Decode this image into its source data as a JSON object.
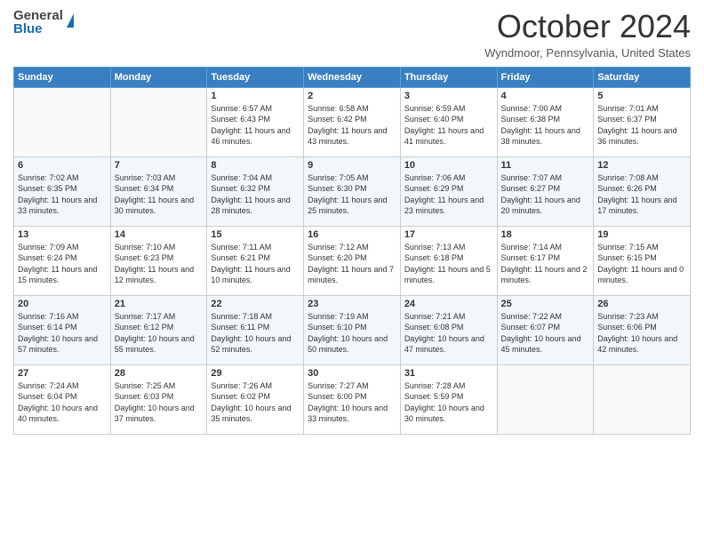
{
  "header": {
    "logo_general": "General",
    "logo_blue": "Blue",
    "month_title": "October 2024",
    "subtitle": "Wyndmoor, Pennsylvania, United States"
  },
  "days_of_week": [
    "Sunday",
    "Monday",
    "Tuesday",
    "Wednesday",
    "Thursday",
    "Friday",
    "Saturday"
  ],
  "weeks": [
    [
      {
        "day": "",
        "detail": ""
      },
      {
        "day": "",
        "detail": ""
      },
      {
        "day": "1",
        "detail": "Sunrise: 6:57 AM\nSunset: 6:43 PM\nDaylight: 11 hours and 46 minutes."
      },
      {
        "day": "2",
        "detail": "Sunrise: 6:58 AM\nSunset: 6:42 PM\nDaylight: 11 hours and 43 minutes."
      },
      {
        "day": "3",
        "detail": "Sunrise: 6:59 AM\nSunset: 6:40 PM\nDaylight: 11 hours and 41 minutes."
      },
      {
        "day": "4",
        "detail": "Sunrise: 7:00 AM\nSunset: 6:38 PM\nDaylight: 11 hours and 38 minutes."
      },
      {
        "day": "5",
        "detail": "Sunrise: 7:01 AM\nSunset: 6:37 PM\nDaylight: 11 hours and 36 minutes."
      }
    ],
    [
      {
        "day": "6",
        "detail": "Sunrise: 7:02 AM\nSunset: 6:35 PM\nDaylight: 11 hours and 33 minutes."
      },
      {
        "day": "7",
        "detail": "Sunrise: 7:03 AM\nSunset: 6:34 PM\nDaylight: 11 hours and 30 minutes."
      },
      {
        "day": "8",
        "detail": "Sunrise: 7:04 AM\nSunset: 6:32 PM\nDaylight: 11 hours and 28 minutes."
      },
      {
        "day": "9",
        "detail": "Sunrise: 7:05 AM\nSunset: 6:30 PM\nDaylight: 11 hours and 25 minutes."
      },
      {
        "day": "10",
        "detail": "Sunrise: 7:06 AM\nSunset: 6:29 PM\nDaylight: 11 hours and 23 minutes."
      },
      {
        "day": "11",
        "detail": "Sunrise: 7:07 AM\nSunset: 6:27 PM\nDaylight: 11 hours and 20 minutes."
      },
      {
        "day": "12",
        "detail": "Sunrise: 7:08 AM\nSunset: 6:26 PM\nDaylight: 11 hours and 17 minutes."
      }
    ],
    [
      {
        "day": "13",
        "detail": "Sunrise: 7:09 AM\nSunset: 6:24 PM\nDaylight: 11 hours and 15 minutes."
      },
      {
        "day": "14",
        "detail": "Sunrise: 7:10 AM\nSunset: 6:23 PM\nDaylight: 11 hours and 12 minutes."
      },
      {
        "day": "15",
        "detail": "Sunrise: 7:11 AM\nSunset: 6:21 PM\nDaylight: 11 hours and 10 minutes."
      },
      {
        "day": "16",
        "detail": "Sunrise: 7:12 AM\nSunset: 6:20 PM\nDaylight: 11 hours and 7 minutes."
      },
      {
        "day": "17",
        "detail": "Sunrise: 7:13 AM\nSunset: 6:18 PM\nDaylight: 11 hours and 5 minutes."
      },
      {
        "day": "18",
        "detail": "Sunrise: 7:14 AM\nSunset: 6:17 PM\nDaylight: 11 hours and 2 minutes."
      },
      {
        "day": "19",
        "detail": "Sunrise: 7:15 AM\nSunset: 6:15 PM\nDaylight: 11 hours and 0 minutes."
      }
    ],
    [
      {
        "day": "20",
        "detail": "Sunrise: 7:16 AM\nSunset: 6:14 PM\nDaylight: 10 hours and 57 minutes."
      },
      {
        "day": "21",
        "detail": "Sunrise: 7:17 AM\nSunset: 6:12 PM\nDaylight: 10 hours and 55 minutes."
      },
      {
        "day": "22",
        "detail": "Sunrise: 7:18 AM\nSunset: 6:11 PM\nDaylight: 10 hours and 52 minutes."
      },
      {
        "day": "23",
        "detail": "Sunrise: 7:19 AM\nSunset: 6:10 PM\nDaylight: 10 hours and 50 minutes."
      },
      {
        "day": "24",
        "detail": "Sunrise: 7:21 AM\nSunset: 6:08 PM\nDaylight: 10 hours and 47 minutes."
      },
      {
        "day": "25",
        "detail": "Sunrise: 7:22 AM\nSunset: 6:07 PM\nDaylight: 10 hours and 45 minutes."
      },
      {
        "day": "26",
        "detail": "Sunrise: 7:23 AM\nSunset: 6:06 PM\nDaylight: 10 hours and 42 minutes."
      }
    ],
    [
      {
        "day": "27",
        "detail": "Sunrise: 7:24 AM\nSunset: 6:04 PM\nDaylight: 10 hours and 40 minutes."
      },
      {
        "day": "28",
        "detail": "Sunrise: 7:25 AM\nSunset: 6:03 PM\nDaylight: 10 hours and 37 minutes."
      },
      {
        "day": "29",
        "detail": "Sunrise: 7:26 AM\nSunset: 6:02 PM\nDaylight: 10 hours and 35 minutes."
      },
      {
        "day": "30",
        "detail": "Sunrise: 7:27 AM\nSunset: 6:00 PM\nDaylight: 10 hours and 33 minutes."
      },
      {
        "day": "31",
        "detail": "Sunrise: 7:28 AM\nSunset: 5:59 PM\nDaylight: 10 hours and 30 minutes."
      },
      {
        "day": "",
        "detail": ""
      },
      {
        "day": "",
        "detail": ""
      }
    ]
  ]
}
